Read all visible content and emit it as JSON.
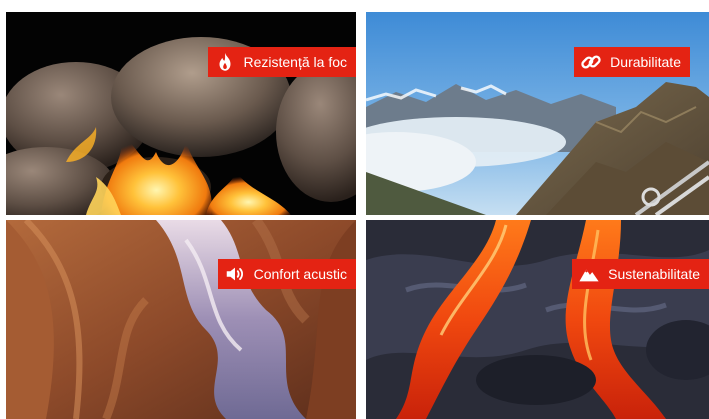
{
  "tiles": [
    {
      "id": "fire",
      "label": "Rezistență la foc",
      "icon": "flame-icon"
    },
    {
      "id": "mountain",
      "label": "Durabilitate",
      "icon": "chain-link-icon"
    },
    {
      "id": "canyon",
      "label": "Confort acustic",
      "icon": "speaker-icon"
    },
    {
      "id": "lava",
      "label": "Sustenabilitate",
      "icon": "mountain-icon"
    }
  ],
  "colors": {
    "label_background": "#e42313",
    "label_text": "#ffffff"
  }
}
